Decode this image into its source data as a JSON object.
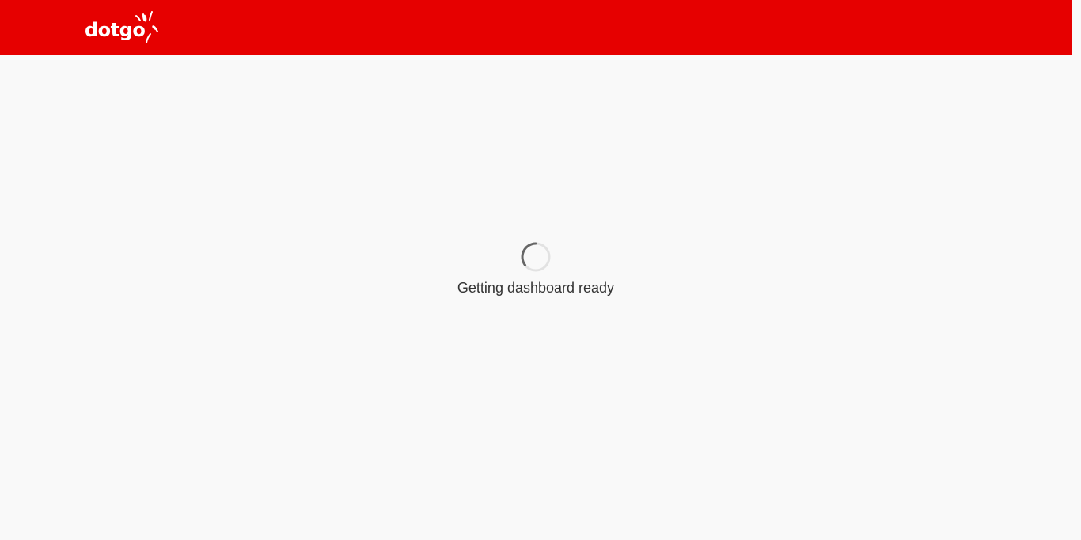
{
  "header": {
    "background_color": "#e60000",
    "logo": {
      "text": "dotgo",
      "icon": "dotgo-sparkle-logo-icon",
      "color": "#ffffff"
    }
  },
  "loading": {
    "spinner_icon": "loading-spinner-icon",
    "message": "Getting dashboard ready"
  }
}
